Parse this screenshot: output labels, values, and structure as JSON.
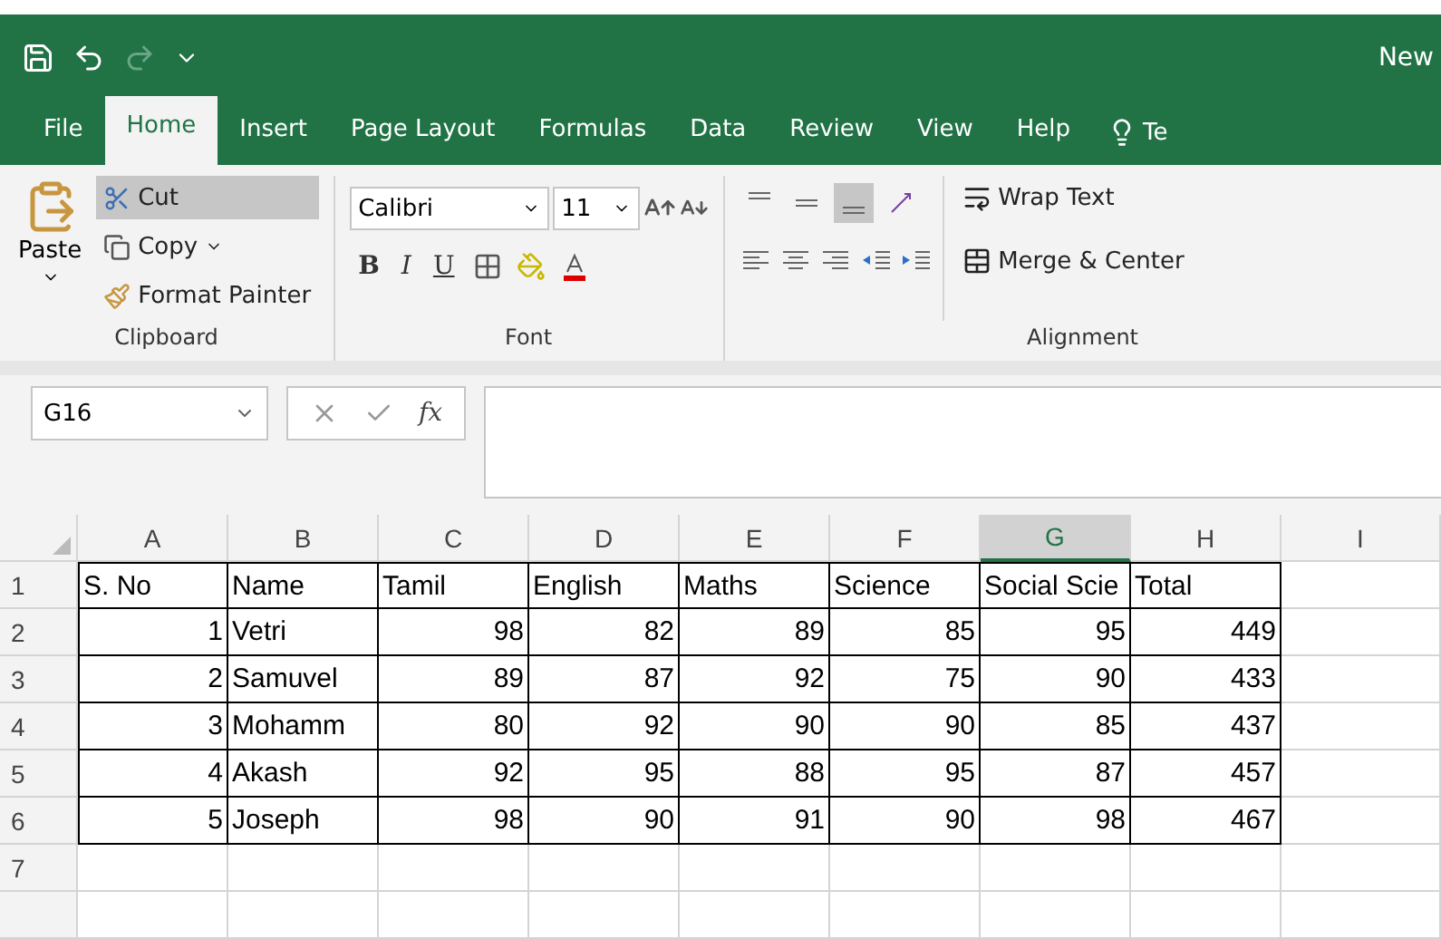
{
  "title_bar": {
    "title": "New"
  },
  "tabs": [
    {
      "label": "File",
      "selected": false
    },
    {
      "label": "Home",
      "selected": true
    },
    {
      "label": "Insert",
      "selected": false
    },
    {
      "label": "Page Layout",
      "selected": false
    },
    {
      "label": "Formulas",
      "selected": false
    },
    {
      "label": "Data",
      "selected": false
    },
    {
      "label": "Review",
      "selected": false
    },
    {
      "label": "View",
      "selected": false
    },
    {
      "label": "Help",
      "selected": false
    }
  ],
  "tell_me": "Te",
  "clipboard": {
    "paste": "Paste",
    "cut": {
      "label": "Cut",
      "highlighted": true
    },
    "copy": {
      "label": "Copy",
      "highlighted": false
    },
    "format_painter": {
      "label": "Format Painter",
      "highlighted": false
    },
    "group_label": "Clipboard"
  },
  "font": {
    "font_name": "Calibri",
    "font_size": "11",
    "format_buttons": [
      "B",
      "I",
      "U"
    ],
    "group_label": "Font"
  },
  "alignment": {
    "vertical_buttons": [
      {
        "kind": "top",
        "selected": false
      },
      {
        "kind": "middle",
        "selected": false
      },
      {
        "kind": "bottom",
        "selected": true
      }
    ],
    "wrap_text": "Wrap Text",
    "merge_center": "Merge & Center",
    "group_label": "Alignment"
  },
  "formula_bar": {
    "name_box": "G16",
    "function_label": "fx"
  },
  "sheet": {
    "columns": [
      {
        "label": "A",
        "selected": false
      },
      {
        "label": "B",
        "selected": false
      },
      {
        "label": "C",
        "selected": false
      },
      {
        "label": "D",
        "selected": false
      },
      {
        "label": "E",
        "selected": false
      },
      {
        "label": "F",
        "selected": false
      },
      {
        "label": "G",
        "selected": true
      },
      {
        "label": "H",
        "selected": false
      },
      {
        "label": "I",
        "selected": false
      }
    ],
    "rows": [
      {
        "number": "1",
        "cells": [
          {
            "text": "S. No",
            "kind": "text"
          },
          {
            "text": "Name",
            "kind": "text"
          },
          {
            "text": "Tamil",
            "kind": "text"
          },
          {
            "text": "English",
            "kind": "text"
          },
          {
            "text": "Maths",
            "kind": "text"
          },
          {
            "text": "Science",
            "kind": "text"
          },
          {
            "text": "Social Scie",
            "kind": "text"
          },
          {
            "text": "Total",
            "kind": "text"
          }
        ]
      },
      {
        "number": "2",
        "cells": [
          {
            "text": "1",
            "kind": "number"
          },
          {
            "text": "Vetri",
            "kind": "text"
          },
          {
            "text": "98",
            "kind": "number"
          },
          {
            "text": "82",
            "kind": "number"
          },
          {
            "text": "89",
            "kind": "number"
          },
          {
            "text": "85",
            "kind": "number"
          },
          {
            "text": "95",
            "kind": "number"
          },
          {
            "text": "449",
            "kind": "number"
          }
        ]
      },
      {
        "number": "3",
        "cells": [
          {
            "text": "2",
            "kind": "number"
          },
          {
            "text": "Samuvel",
            "kind": "text"
          },
          {
            "text": "89",
            "kind": "number"
          },
          {
            "text": "87",
            "kind": "number"
          },
          {
            "text": "92",
            "kind": "number"
          },
          {
            "text": "75",
            "kind": "number"
          },
          {
            "text": "90",
            "kind": "number"
          },
          {
            "text": "433",
            "kind": "number"
          }
        ]
      },
      {
        "number": "4",
        "cells": [
          {
            "text": "3",
            "kind": "number"
          },
          {
            "text": "Mohamm",
            "kind": "text"
          },
          {
            "text": "80",
            "kind": "number"
          },
          {
            "text": "92",
            "kind": "number"
          },
          {
            "text": "90",
            "kind": "number"
          },
          {
            "text": "90",
            "kind": "number"
          },
          {
            "text": "85",
            "kind": "number"
          },
          {
            "text": "437",
            "kind": "number"
          }
        ]
      },
      {
        "number": "5",
        "cells": [
          {
            "text": "4",
            "kind": "number"
          },
          {
            "text": "Akash",
            "kind": "text"
          },
          {
            "text": "92",
            "kind": "number"
          },
          {
            "text": "95",
            "kind": "number"
          },
          {
            "text": "88",
            "kind": "number"
          },
          {
            "text": "95",
            "kind": "number"
          },
          {
            "text": "87",
            "kind": "number"
          },
          {
            "text": "457",
            "kind": "number"
          }
        ]
      },
      {
        "number": "6",
        "cells": [
          {
            "text": "5",
            "kind": "number"
          },
          {
            "text": "Joseph",
            "kind": "text"
          },
          {
            "text": "98",
            "kind": "number"
          },
          {
            "text": "90",
            "kind": "number"
          },
          {
            "text": "91",
            "kind": "number"
          },
          {
            "text": "90",
            "kind": "number"
          },
          {
            "text": "98",
            "kind": "number"
          },
          {
            "text": "467",
            "kind": "number"
          }
        ]
      },
      {
        "number": "7",
        "cells": []
      }
    ]
  }
}
